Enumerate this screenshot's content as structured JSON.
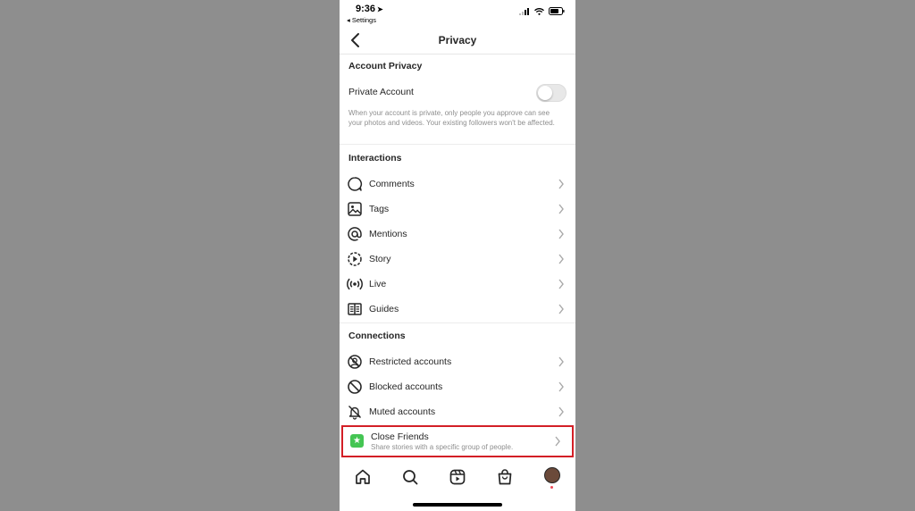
{
  "status_bar": {
    "time": "9:36",
    "back_label": "◂ Settings"
  },
  "nav": {
    "title": "Privacy"
  },
  "account_privacy": {
    "title": "Account Privacy",
    "private_label": "Private Account",
    "private_enabled": false,
    "description": "When your account is private, only people you approve can see your photos and videos. Your existing followers won't be affected."
  },
  "interactions": {
    "title": "Interactions",
    "items": [
      {
        "label": "Comments",
        "icon": "comment-icon"
      },
      {
        "label": "Tags",
        "icon": "tag-photo-icon"
      },
      {
        "label": "Mentions",
        "icon": "mention-icon"
      },
      {
        "label": "Story",
        "icon": "story-icon"
      },
      {
        "label": "Live",
        "icon": "live-icon"
      },
      {
        "label": "Guides",
        "icon": "guides-icon"
      }
    ]
  },
  "connections": {
    "title": "Connections",
    "items": [
      {
        "label": "Restricted accounts",
        "icon": "restricted-icon"
      },
      {
        "label": "Blocked accounts",
        "icon": "blocked-icon"
      },
      {
        "label": "Muted accounts",
        "icon": "muted-bell-icon"
      }
    ],
    "close_friends": {
      "label": "Close Friends",
      "subtitle": "Share stories with a specific group of people.",
      "icon": "star-icon",
      "highlight_color": "#d31f26",
      "icon_color": "#44c553"
    }
  },
  "tabbar": {
    "tabs": [
      "home-icon",
      "search-icon",
      "reels-icon",
      "shop-icon",
      "profile-avatar"
    ]
  }
}
